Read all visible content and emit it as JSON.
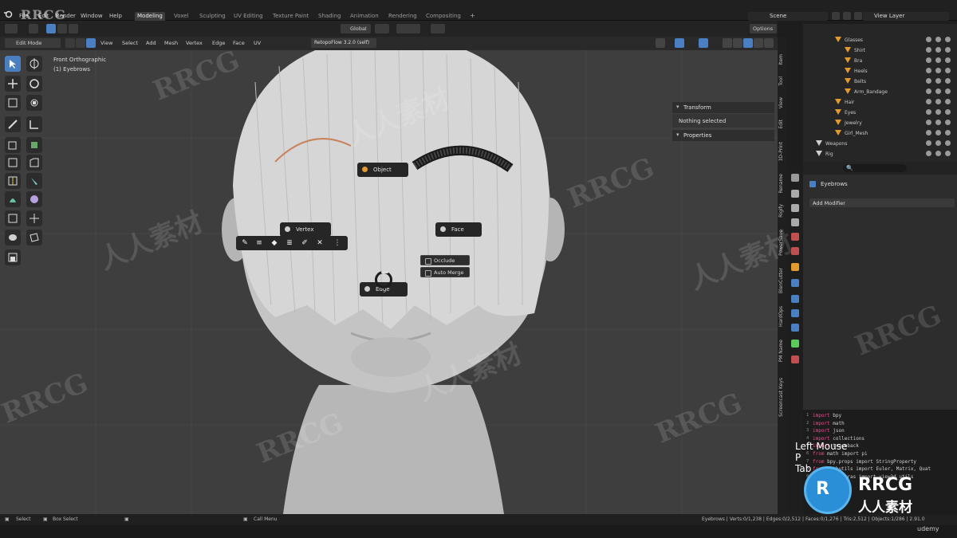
{
  "menubar": {
    "items": [
      "File",
      "Edit",
      "Render",
      "Window",
      "Help"
    ],
    "workspaces": [
      "Modeling",
      "Voxel",
      "Sculpting",
      "UV Editing",
      "Texture Paint",
      "Shading",
      "Animation",
      "Rendering",
      "Compositing"
    ],
    "active_workspace": "Modeling",
    "add_tab": "+",
    "scene": "Scene",
    "view_layer": "View Layer"
  },
  "header": {
    "mode": "Edit Mode",
    "menus": [
      "View",
      "Select",
      "Add",
      "Mesh",
      "Vertex",
      "Edge",
      "Face",
      "UV"
    ],
    "transform_orientation": "Global",
    "addon_button": "RetopoFlow 3.2.0 (self)",
    "options": "Options"
  },
  "viewport": {
    "view_name": "Front Orthographic",
    "object_label": "(1) Eyebrows"
  },
  "pie_menu": {
    "object": "Object",
    "vertex": "Vertex",
    "face": "Face",
    "edge": "Edge",
    "sub_items": [
      "Occlude",
      "Auto Merge"
    ]
  },
  "npanel": {
    "transform": "Transform",
    "nothing_selected": "Nothing selected",
    "properties": "Properties"
  },
  "sidetabs": [
    "Item",
    "Tool",
    "View",
    "Edit",
    "3D-Print",
    "Rename",
    "Rigify",
    "PowerSave",
    "BlenCutter",
    "HardOps",
    "PM Name",
    "Screencast Keys"
  ],
  "outliner": {
    "rows": [
      {
        "name": "Glasses",
        "indent": 0
      },
      {
        "name": "Shirt",
        "indent": 1
      },
      {
        "name": "Bra",
        "indent": 1
      },
      {
        "name": "Heels",
        "indent": 1
      },
      {
        "name": "Belts",
        "indent": 1
      },
      {
        "name": "Arm_Bandage",
        "indent": 1
      },
      {
        "name": "Hair",
        "indent": 0
      },
      {
        "name": "Eyes",
        "indent": 0
      },
      {
        "name": "Jewelry",
        "indent": 0
      },
      {
        "name": "Girl_Mesh",
        "indent": 0
      },
      {
        "name": "Weapons",
        "indent": -1
      },
      {
        "name": "Rig",
        "indent": -1
      }
    ],
    "search_icon": "🔍"
  },
  "properties": {
    "object": "Eyebrows",
    "add_modifier": "Add Modifier"
  },
  "console": {
    "lines": [
      {
        "n": "1",
        "kw": "import",
        "rest": " bpy"
      },
      {
        "n": "2",
        "kw": "import",
        "rest": " math"
      },
      {
        "n": "3",
        "kw": "import",
        "rest": " json"
      },
      {
        "n": "4",
        "kw": "import",
        "rest": " collections"
      },
      {
        "n": "5",
        "kw": "import",
        "rest": " traceback"
      },
      {
        "n": "6",
        "kw": "from",
        "rest": " math import pi"
      },
      {
        "n": "7",
        "kw": "from",
        "rest": " bpy.props import StringProperty"
      },
      {
        "n": "8",
        "kw": "from",
        "rest": " mathutils import Euler, Matrix, Quat"
      },
      {
        "n": "9",
        "kw": "from",
        "rest": " bpy_extras import view3d_utils"
      },
      {
        "n": "10",
        "kw": "",
        "rest": ""
      }
    ]
  },
  "key_overlay": [
    "Left Mouse",
    "P",
    "Tab"
  ],
  "statusbar": {
    "select": "Select",
    "box_select": "Box Select",
    "call_menu": "Call Menu",
    "stats": "Eyebrows | Verts:0/1,238 | Edges:0/2,512 | Faces:0/1,276 | Tris:2,512 | Objects:1/286 | 2.91.0"
  },
  "watermark": {
    "brand": "RRCG",
    "cn": "人人素材",
    "udemy": "udemy"
  },
  "colors": {
    "accent": "#4a7fc1",
    "orange": "#e39a2e",
    "viewport_bg": "#3e3e3e"
  }
}
